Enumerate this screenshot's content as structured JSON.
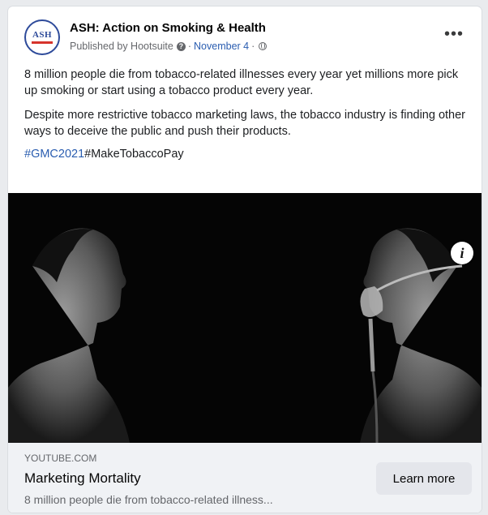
{
  "post": {
    "page_name": "ASH: Action on Smoking & Health",
    "avatar_text": "ASH",
    "published_by": "Published by Hootsuite",
    "date": "November 4",
    "more_label": "•••",
    "paragraphs": [
      "8 million people die from tobacco-related illnesses every year yet millions more pick up smoking or start using a tobacco product every year.",
      "Despite more restrictive tobacco marketing laws, the tobacco industry is finding other ways to deceive the public and push their products."
    ],
    "hashtags": [
      "#GMC2021",
      "#MakeTobaccoPay"
    ]
  },
  "link_preview": {
    "domain": "YOUTUBE.COM",
    "title": "Marketing Mortality",
    "description": "8 million people die from tobacco-related illness...",
    "cta_label": "Learn more",
    "info_label": "i"
  },
  "colors": {
    "link": "#2a5db0",
    "brand_blue": "#2d4a9a",
    "brand_red": "#d6342c"
  }
}
